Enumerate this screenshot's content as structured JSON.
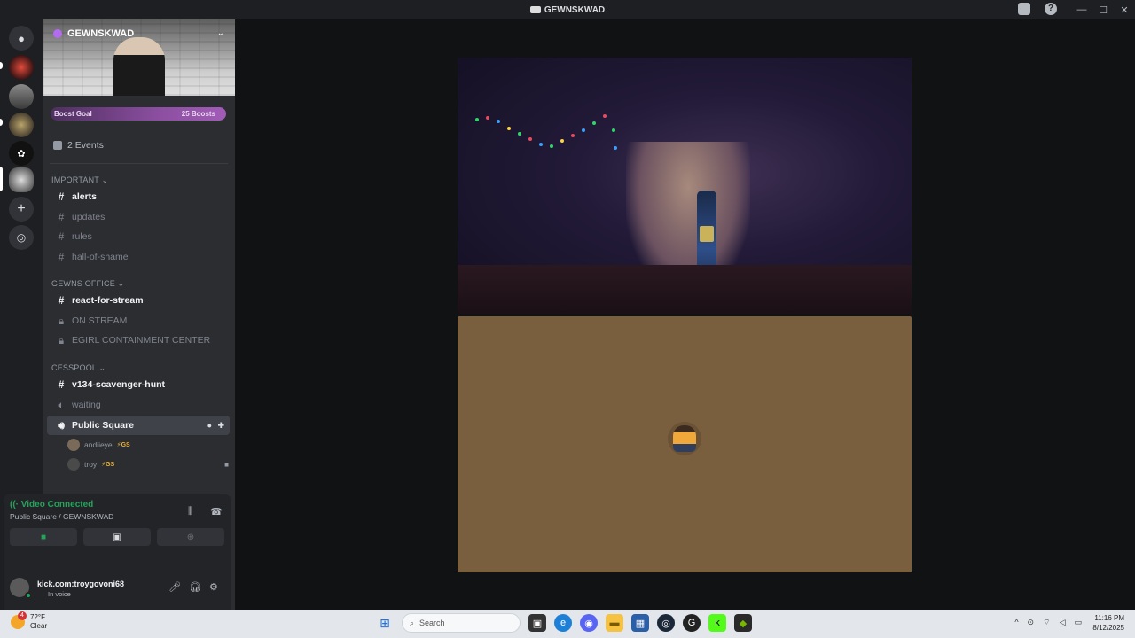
{
  "window": {
    "title": "GEWNSKWAD"
  },
  "server": {
    "name": "GEWNSKWAD",
    "boost_goal": "Boost Goal",
    "boost_count": "25 Boosts",
    "events": "2 Events"
  },
  "categories": [
    {
      "name": "IMPORTANT",
      "channels": [
        {
          "name": "alerts"
        },
        {
          "name": "updates"
        },
        {
          "name": "rules"
        },
        {
          "name": "hall-of-shame"
        }
      ]
    },
    {
      "name": "GEWNS OFFICE",
      "channels": [
        {
          "name": "react-for-stream"
        },
        {
          "name": "ON STREAM"
        },
        {
          "name": "EGIRL CONTAINMENT CENTER"
        }
      ]
    },
    {
      "name": "CESSPOOL",
      "channels": [
        {
          "name": "v134-scavenger-hunt"
        },
        {
          "name": "waiting"
        },
        {
          "name": "Public Square"
        }
      ]
    }
  ],
  "voice_members": [
    {
      "name": "andiieye",
      "tag": "GS"
    },
    {
      "name": "troy",
      "tag": "GS"
    }
  ],
  "voice_panel": {
    "status": "Video Connected",
    "location": "Public Square / GEWNSKWAD"
  },
  "user": {
    "name": "kick.com:troygovoni68",
    "status": "In voice"
  },
  "taskbar": {
    "weather_temp": "72°F",
    "weather_desc": "Clear",
    "weather_badge": "4",
    "search_placeholder": "Search",
    "time": "11:16 PM",
    "date": "8/12/2025"
  },
  "colors": {
    "accent_green": "#23a55a",
    "boost_purple": "#a25cb8",
    "avatar_tile": "#7a5f3f"
  }
}
